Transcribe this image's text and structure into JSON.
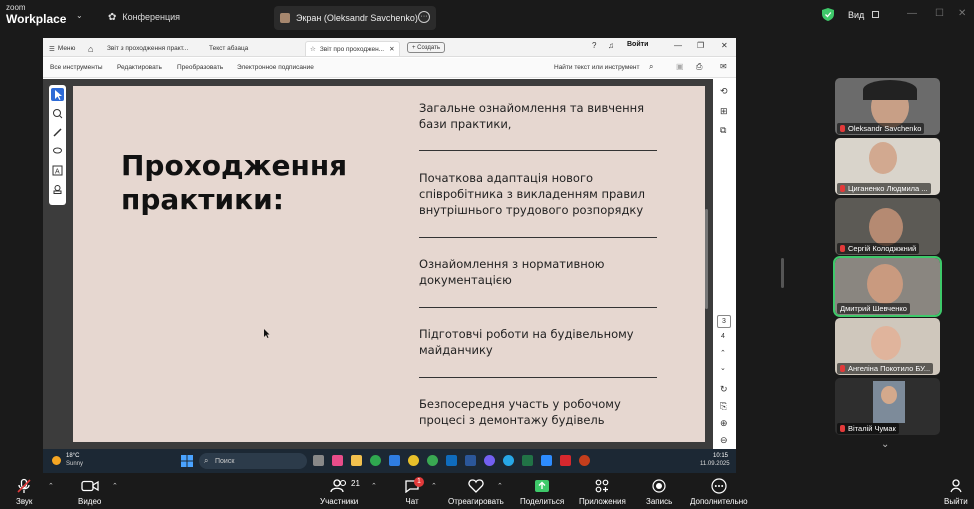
{
  "zoom": {
    "logo_top": "zoom",
    "logo_bottom": "Workplace",
    "conference_tab": "Конференция",
    "share_tab": "Экран (Oleksandr Savchenko)",
    "view_label": "Вид",
    "colors": {
      "bg": "#1a1a1a",
      "green": "#3ec96a",
      "red": "#e23a3a"
    }
  },
  "acrobat": {
    "menu": "Меню",
    "tabs": [
      "Звіт з проходження практ...",
      "Текст абзаца",
      "Звіт про проходжен..."
    ],
    "create": "Создать",
    "login": "Войти",
    "tools": [
      "Все инструменты",
      "Редактировать",
      "Преобразовать",
      "Электронное подписание"
    ],
    "search": "Найти текст или инструмент",
    "page_current": "3",
    "page_next": "4"
  },
  "slide": {
    "title_line1": "Проходження",
    "title_line2": "практики:",
    "items": [
      "Загальне ознайомлення та вивчення бази практики,",
      "Початкова адаптація нового співробітника з викладенням правил внутрішнього трудового розпорядку",
      "Ознайомлення з нормативною документацією",
      "Підготовчі роботи на будівельному майданчику",
      "Безпосередня участь у робочому процесі з демонтажу будівель"
    ],
    "bg_color": "#e6d7d0"
  },
  "taskbar": {
    "weather_temp": "18°C",
    "weather_desc": "Sunny",
    "search": "Поиск",
    "time": "10:15",
    "date": "11.09.2025"
  },
  "participants": [
    {
      "name": "Oleksandr Savchenko"
    },
    {
      "name": "Циганенко Людмила ..."
    },
    {
      "name": "Сергій Колоджжний"
    },
    {
      "name": "Дмитрий Шевченко"
    },
    {
      "name": "Ангеліна Покотило БУ..."
    },
    {
      "name": "Віталій Чумак"
    }
  ],
  "toolbar": {
    "audio": "Звук",
    "video": "Видео",
    "participants": "Участники",
    "participants_count": "21",
    "chat": "Чат",
    "chat_badge": "1",
    "react": "Отреагировать",
    "share": "Поделиться",
    "apps": "Приложения",
    "record": "Запись",
    "more": "Дополнительно",
    "leave": "Выйти"
  }
}
